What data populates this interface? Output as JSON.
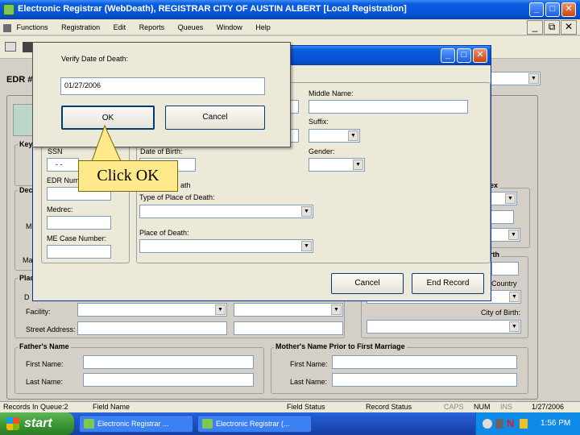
{
  "app": {
    "title": "Electronic Registrar (WebDeath), REGISTRAR   CITY OF AUSTIN   ALBERT   [Local Registration]"
  },
  "menu": [
    "Functions",
    "Registration",
    "Edit",
    "Reports",
    "Queues",
    "Window",
    "Help"
  ],
  "main": {
    "edr_label": "EDR #",
    "groups": {
      "key": "Key",
      "decedent": "Dec",
      "place": "Plac",
      "father": "Father's Name",
      "mother": "Mother's Name Prior to First Marriage",
      "right_sex": "ex",
      "right_birth": "rth"
    },
    "labels": {
      "facility": "Facility:",
      "street_address": "Street Address:",
      "country": "Country",
      "city_of_birth": "City of Birth:",
      "father_first": "First Name:",
      "father_last": "Last Name:",
      "mother_first": "First Name:",
      "mother_last": "Last Name:",
      "left_m": "M",
      "left_ma": "Ma",
      "left_d": "D"
    }
  },
  "search_dialog": {
    "labels": {
      "middle_name": "Middle Name:",
      "suffix": "Suffix:",
      "ssn": "SSN",
      "date_of_birth": "Date of Birth:",
      "gender": "Gender:",
      "edr_number": "EDR Num",
      "death_partial": "ath",
      "type_of_place": "Type of Place of Death:",
      "medrec": "Medrec:",
      "me_case_number": "ME Case Number:",
      "place_of_death": "Place of Death:"
    },
    "ssn_value": "- -",
    "buttons": {
      "cancel": "Cancel",
      "end_record": "End Record"
    }
  },
  "verify_dialog": {
    "label": "Verify Date of Death:",
    "value": "01/27/2006",
    "ok": "OK",
    "cancel": "Cancel"
  },
  "callout": {
    "text": "Click OK"
  },
  "statusbar": {
    "records_in_queue": "Records In Queue:2",
    "field_name": "Field Name",
    "field_status": "Field Status",
    "record_status": "Record Status",
    "caps": "CAPS",
    "num": "NUM",
    "ins": "INS",
    "date": "1/27/2006"
  },
  "taskbar": {
    "start": "start",
    "items": [
      "Electronic Registrar ...",
      "Electronic Registrar (..."
    ],
    "time": "1:56 PM"
  },
  "colors": {
    "titlebar": "#0752d6",
    "window_bg": "#d4d0c8",
    "dialog_bg": "#ece9d8",
    "callout": "#ffe98a",
    "start_green": "#389330"
  }
}
